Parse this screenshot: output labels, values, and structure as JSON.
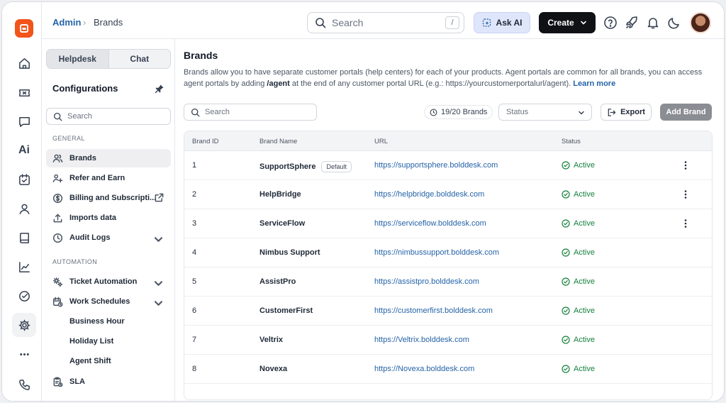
{
  "breadcrumb": {
    "root": "Admin",
    "current": "Brands"
  },
  "header": {
    "search_placeholder": "Search",
    "search_shortcut": "/",
    "ask_ai_label": "Ask AI",
    "create_label": "Create"
  },
  "config": {
    "tabs": [
      "Helpdesk",
      "Chat"
    ],
    "title": "Configurations",
    "search_placeholder": "Search",
    "section_general": "GENERAL",
    "section_automation": "AUTOMATION",
    "general_items": [
      "Brands",
      "Refer and Earn",
      "Billing and Subscripti...",
      "Imports data",
      "Audit Logs"
    ],
    "automation_items": [
      "Ticket Automation",
      "Work Schedules"
    ],
    "work_schedule_subitems": [
      "Business Hour",
      "Holiday List",
      "Agent Shift"
    ],
    "sla_label": "SLA"
  },
  "main": {
    "title": "Brands",
    "desc_part1": "Brands allow you to have separate customer portals (help centers) for each of your products. Agent portals are common for all brands, you can access agent portals by adding ",
    "desc_agent": "/agent",
    "desc_part2": " at the end of any customer portal URL (e.g.: https://yourcustomerportalurl/agent). ",
    "learn_more": "Learn more",
    "search_placeholder": "Search",
    "brand_count": "19/20 Brands",
    "status_placeholder": "Status",
    "export_label": "Export",
    "add_brand_label": "Add Brand"
  },
  "table": {
    "columns": [
      "Brand ID",
      "Brand Name",
      "URL",
      "Status"
    ],
    "default_tag": "Default",
    "rows": [
      {
        "id": "1",
        "name": "SupportSphere",
        "url": "https://supportsphere.bolddesk.com",
        "status": "Active"
      },
      {
        "id": "2",
        "name": "HelpBridge",
        "url": "https://helpbridge.bolddesk.com",
        "status": "Active"
      },
      {
        "id": "3",
        "name": "ServiceFlow",
        "url": "https://serviceflow.bolddesk.com",
        "status": "Active"
      },
      {
        "id": "4",
        "name": "Nimbus Support",
        "url": "https://nimbussupport.bolddesk.com",
        "status": "Active"
      },
      {
        "id": "5",
        "name": "AssistPro",
        "url": "https://assistpro.bolddesk.com",
        "status": "Active"
      },
      {
        "id": "6",
        "name": "CustomerFirst",
        "url": "https://customerfirst.bolddesk.com",
        "status": "Active"
      },
      {
        "id": "7",
        "name": "Veltrix",
        "url": "https://Veltrix.bolddesk.com",
        "status": "Active"
      },
      {
        "id": "8",
        "name": "Novexa",
        "url": "https://Novexa.bolddesk.com",
        "status": "Active"
      }
    ]
  },
  "colors": {
    "brand": "#f2541b",
    "link": "#2563a8",
    "active": "#15803d"
  }
}
